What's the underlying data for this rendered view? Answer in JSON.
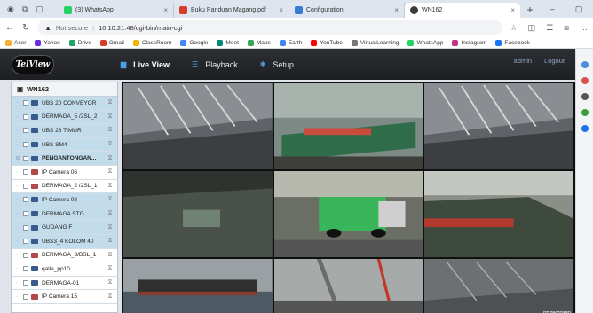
{
  "browser": {
    "tabs": [
      {
        "title": "(3) WhatsApp",
        "favicon_color": "#25d366",
        "active": false
      },
      {
        "title": "Buku Panduan Magang.pdf",
        "favicon_color": "#d93b2b",
        "active": false
      },
      {
        "title": "Configuration",
        "favicon_color": "#3a7bd5",
        "active": false
      },
      {
        "title": "WN162",
        "favicon_color": "#3b3b3b",
        "active": true
      }
    ],
    "security_label": "Not secure",
    "url": "10.10.21.48/cgi-bin/main-cgi",
    "bookmarks": [
      {
        "label": "Acer",
        "color": "#f2b233"
      },
      {
        "label": "Yahoo",
        "color": "#6b2bd9"
      },
      {
        "label": "Drive",
        "color": "#1fa463"
      },
      {
        "label": "Gmail",
        "color": "#d93b2b"
      },
      {
        "label": "ClassRoom",
        "color": "#f4b400"
      },
      {
        "label": "Google",
        "color": "#4285f4"
      },
      {
        "label": "Meet",
        "color": "#00897b"
      },
      {
        "label": "Maps",
        "color": "#34a853"
      },
      {
        "label": "Earth",
        "color": "#4285f4"
      },
      {
        "label": "YouTube",
        "color": "#ff0000"
      },
      {
        "label": "VirtualLearning",
        "color": "#777777"
      },
      {
        "label": "WhatsApp",
        "color": "#25d366"
      },
      {
        "label": "Instagram",
        "color": "#c13584"
      },
      {
        "label": "Facebook",
        "color": "#1877f2"
      }
    ]
  },
  "app": {
    "logo_text": "TelView",
    "nav": [
      {
        "label": "Live View",
        "icon": "monitor-icon",
        "active": true
      },
      {
        "label": "Playback",
        "icon": "list-icon",
        "active": false
      },
      {
        "label": "Setup",
        "icon": "gear-icon",
        "active": false
      }
    ],
    "user": "admin",
    "logout": "Logout",
    "accent_color": "#4aa0e0"
  },
  "tree": {
    "root": "WN162",
    "items": [
      {
        "label": "UBS 20 CONVEYOR",
        "selected": true,
        "group": false,
        "cam_color": "#3a5a8c"
      },
      {
        "label": "DERMAGA_5 /2SL_2",
        "selected": true,
        "group": false,
        "cam_color": "#3a5a8c"
      },
      {
        "label": "UBS 28 TIMUR",
        "selected": true,
        "group": false,
        "cam_color": "#3a5a8c"
      },
      {
        "label": "UBS SM4",
        "selected": true,
        "group": false,
        "cam_color": "#3a5a8c"
      },
      {
        "label": "PENGANTONGAN...",
        "selected": true,
        "group": true,
        "cam_color": "#3a5a8c"
      },
      {
        "label": "IP Camera 06",
        "selected": false,
        "group": false,
        "cam_color": "#b24a4a"
      },
      {
        "label": "DERMAGA_2 /2SL_1",
        "selected": false,
        "group": false,
        "cam_color": "#b24a4a"
      },
      {
        "label": "IP Camera 08",
        "selected": true,
        "group": false,
        "cam_color": "#3a5a8c"
      },
      {
        "label": "DERMAGA STG",
        "selected": true,
        "group": false,
        "cam_color": "#3a5a8c"
      },
      {
        "label": "GUDANG F",
        "selected": true,
        "group": false,
        "cam_color": "#3a5a8c"
      },
      {
        "label": "UBS3_4 KOLOM 40",
        "selected": true,
        "group": false,
        "cam_color": "#3a5a8c"
      },
      {
        "label": "DERMAGA_3/BSL_1",
        "selected": false,
        "group": false,
        "cam_color": "#b24a4a"
      },
      {
        "label": "qalie_pp10",
        "selected": false,
        "group": false,
        "cam_color": "#3a5a8c"
      },
      {
        "label": "DERMAGA-01",
        "selected": false,
        "group": false,
        "cam_color": "#3a5a8c"
      },
      {
        "label": "IP Camera 15",
        "selected": false,
        "group": false,
        "cam_color": "#b24a4a"
      }
    ]
  },
  "video": {
    "tiles": [
      {
        "scene": "warehouse",
        "active": false
      },
      {
        "scene": "dock",
        "active": false
      },
      {
        "scene": "warehouse",
        "active": false
      },
      {
        "scene": "dark",
        "active": false
      },
      {
        "scene": "truck",
        "active": true
      },
      {
        "scene": "dock-ship",
        "active": false
      },
      {
        "scene": "barge",
        "active": false
      },
      {
        "scene": "crane",
        "active": false
      },
      {
        "scene": "warehouse-dark",
        "active": false
      }
    ],
    "watermark": "PT.PIKTONIR"
  }
}
